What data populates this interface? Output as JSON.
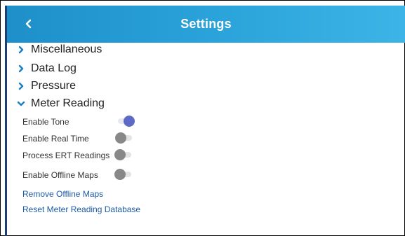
{
  "header": {
    "title": "Settings"
  },
  "sections": [
    {
      "label": "Miscellaneous",
      "expanded": false
    },
    {
      "label": "Data Log",
      "expanded": false
    },
    {
      "label": "Pressure",
      "expanded": false
    },
    {
      "label": "Meter Reading",
      "expanded": true
    }
  ],
  "meter_reading": {
    "toggles": [
      {
        "label": "Enable Tone",
        "on": true
      },
      {
        "label": "Enable Real Time",
        "on": false
      },
      {
        "label": "Process ERT Readings",
        "on": false
      },
      {
        "label": "Enable Offline Maps",
        "on": false
      }
    ],
    "links": [
      {
        "label": "Remove Offline Maps"
      },
      {
        "label": "Reset Meter Reading Database"
      }
    ]
  },
  "colors": {
    "header_accent": "#2ba4db",
    "toggle_on": "#5d6bc4",
    "toggle_off": "#888888",
    "link": "#1a5aa8",
    "chevron": "#1a7fc0"
  }
}
